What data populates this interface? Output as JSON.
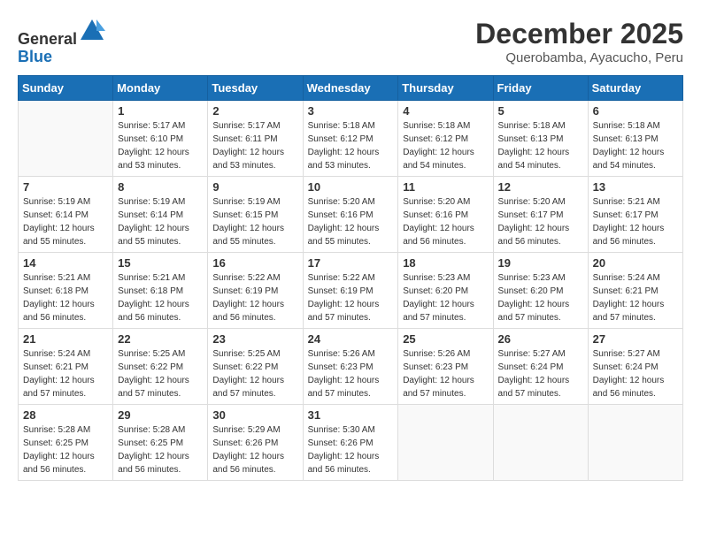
{
  "header": {
    "logo_general": "General",
    "logo_blue": "Blue",
    "month_title": "December 2025",
    "location": "Querobamba, Ayacucho, Peru"
  },
  "days_of_week": [
    "Sunday",
    "Monday",
    "Tuesday",
    "Wednesday",
    "Thursday",
    "Friday",
    "Saturday"
  ],
  "weeks": [
    [
      {
        "day": "",
        "info": ""
      },
      {
        "day": "1",
        "info": "Sunrise: 5:17 AM\nSunset: 6:10 PM\nDaylight: 12 hours\nand 53 minutes."
      },
      {
        "day": "2",
        "info": "Sunrise: 5:17 AM\nSunset: 6:11 PM\nDaylight: 12 hours\nand 53 minutes."
      },
      {
        "day": "3",
        "info": "Sunrise: 5:18 AM\nSunset: 6:12 PM\nDaylight: 12 hours\nand 53 minutes."
      },
      {
        "day": "4",
        "info": "Sunrise: 5:18 AM\nSunset: 6:12 PM\nDaylight: 12 hours\nand 54 minutes."
      },
      {
        "day": "5",
        "info": "Sunrise: 5:18 AM\nSunset: 6:13 PM\nDaylight: 12 hours\nand 54 minutes."
      },
      {
        "day": "6",
        "info": "Sunrise: 5:18 AM\nSunset: 6:13 PM\nDaylight: 12 hours\nand 54 minutes."
      }
    ],
    [
      {
        "day": "7",
        "info": "Sunrise: 5:19 AM\nSunset: 6:14 PM\nDaylight: 12 hours\nand 55 minutes."
      },
      {
        "day": "8",
        "info": "Sunrise: 5:19 AM\nSunset: 6:14 PM\nDaylight: 12 hours\nand 55 minutes."
      },
      {
        "day": "9",
        "info": "Sunrise: 5:19 AM\nSunset: 6:15 PM\nDaylight: 12 hours\nand 55 minutes."
      },
      {
        "day": "10",
        "info": "Sunrise: 5:20 AM\nSunset: 6:16 PM\nDaylight: 12 hours\nand 55 minutes."
      },
      {
        "day": "11",
        "info": "Sunrise: 5:20 AM\nSunset: 6:16 PM\nDaylight: 12 hours\nand 56 minutes."
      },
      {
        "day": "12",
        "info": "Sunrise: 5:20 AM\nSunset: 6:17 PM\nDaylight: 12 hours\nand 56 minutes."
      },
      {
        "day": "13",
        "info": "Sunrise: 5:21 AM\nSunset: 6:17 PM\nDaylight: 12 hours\nand 56 minutes."
      }
    ],
    [
      {
        "day": "14",
        "info": "Sunrise: 5:21 AM\nSunset: 6:18 PM\nDaylight: 12 hours\nand 56 minutes."
      },
      {
        "day": "15",
        "info": "Sunrise: 5:21 AM\nSunset: 6:18 PM\nDaylight: 12 hours\nand 56 minutes."
      },
      {
        "day": "16",
        "info": "Sunrise: 5:22 AM\nSunset: 6:19 PM\nDaylight: 12 hours\nand 56 minutes."
      },
      {
        "day": "17",
        "info": "Sunrise: 5:22 AM\nSunset: 6:19 PM\nDaylight: 12 hours\nand 57 minutes."
      },
      {
        "day": "18",
        "info": "Sunrise: 5:23 AM\nSunset: 6:20 PM\nDaylight: 12 hours\nand 57 minutes."
      },
      {
        "day": "19",
        "info": "Sunrise: 5:23 AM\nSunset: 6:20 PM\nDaylight: 12 hours\nand 57 minutes."
      },
      {
        "day": "20",
        "info": "Sunrise: 5:24 AM\nSunset: 6:21 PM\nDaylight: 12 hours\nand 57 minutes."
      }
    ],
    [
      {
        "day": "21",
        "info": "Sunrise: 5:24 AM\nSunset: 6:21 PM\nDaylight: 12 hours\nand 57 minutes."
      },
      {
        "day": "22",
        "info": "Sunrise: 5:25 AM\nSunset: 6:22 PM\nDaylight: 12 hours\nand 57 minutes."
      },
      {
        "day": "23",
        "info": "Sunrise: 5:25 AM\nSunset: 6:22 PM\nDaylight: 12 hours\nand 57 minutes."
      },
      {
        "day": "24",
        "info": "Sunrise: 5:26 AM\nSunset: 6:23 PM\nDaylight: 12 hours\nand 57 minutes."
      },
      {
        "day": "25",
        "info": "Sunrise: 5:26 AM\nSunset: 6:23 PM\nDaylight: 12 hours\nand 57 minutes."
      },
      {
        "day": "26",
        "info": "Sunrise: 5:27 AM\nSunset: 6:24 PM\nDaylight: 12 hours\nand 57 minutes."
      },
      {
        "day": "27",
        "info": "Sunrise: 5:27 AM\nSunset: 6:24 PM\nDaylight: 12 hours\nand 56 minutes."
      }
    ],
    [
      {
        "day": "28",
        "info": "Sunrise: 5:28 AM\nSunset: 6:25 PM\nDaylight: 12 hours\nand 56 minutes."
      },
      {
        "day": "29",
        "info": "Sunrise: 5:28 AM\nSunset: 6:25 PM\nDaylight: 12 hours\nand 56 minutes."
      },
      {
        "day": "30",
        "info": "Sunrise: 5:29 AM\nSunset: 6:26 PM\nDaylight: 12 hours\nand 56 minutes."
      },
      {
        "day": "31",
        "info": "Sunrise: 5:30 AM\nSunset: 6:26 PM\nDaylight: 12 hours\nand 56 minutes."
      },
      {
        "day": "",
        "info": ""
      },
      {
        "day": "",
        "info": ""
      },
      {
        "day": "",
        "info": ""
      }
    ]
  ]
}
